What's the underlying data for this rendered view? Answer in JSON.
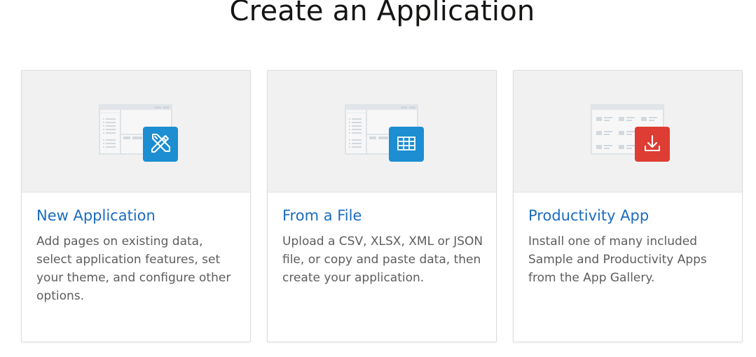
{
  "page": {
    "title": "Create an Application"
  },
  "cards": [
    {
      "title": "New Application",
      "description": "Add pages on existing data, select application features, set your theme, and configure other options.",
      "icon": "pencil-ruler-icon",
      "badge_color": "#1c8ed1"
    },
    {
      "title": "From a File",
      "description": "Upload a CSV, XLSX, XML or JSON file, or copy and paste data, then create your application.",
      "icon": "table-grid-icon",
      "badge_color": "#1c8ed1"
    },
    {
      "title": "Productivity App",
      "description": "Install one of many included Sample and Productivity Apps from the App Gallery.",
      "icon": "download-icon",
      "badge_color": "#dd3d32"
    }
  ]
}
